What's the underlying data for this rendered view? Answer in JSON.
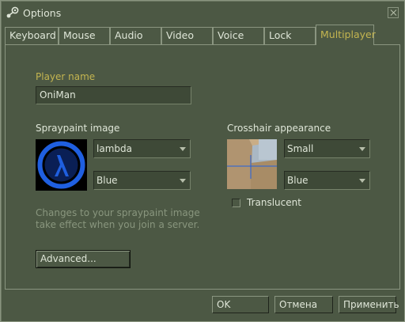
{
  "window": {
    "title": "Options",
    "icon": "steam-icon",
    "close_icon": "close-icon"
  },
  "tabs": [
    {
      "label": "Keyboard"
    },
    {
      "label": "Mouse"
    },
    {
      "label": "Audio"
    },
    {
      "label": "Video"
    },
    {
      "label": "Voice"
    },
    {
      "label": "Lock"
    },
    {
      "label": "Multiplayer",
      "active": true
    }
  ],
  "player": {
    "label": "Player name",
    "value": "OniMan"
  },
  "spray": {
    "label": "Spraypaint image",
    "image_icon": "lambda-logo",
    "image_dropdown": "lambda",
    "color_dropdown": "Blue",
    "hint": "Changes to your spraypaint image take effect when you join a server."
  },
  "crosshair": {
    "label": "Crosshair appearance",
    "size_dropdown": "Small",
    "color_dropdown": "Blue",
    "translucent_label": "Translucent",
    "translucent_checked": false
  },
  "buttons": {
    "advanced": "Advanced...",
    "ok": "OK",
    "cancel": "Отмена",
    "apply": "Применить"
  },
  "colors": {
    "accent": "#c4b550",
    "background": "#4c5844",
    "border": "#8a9580",
    "text": "#dfe6d8",
    "spray_blue": "#1f5fe0"
  }
}
